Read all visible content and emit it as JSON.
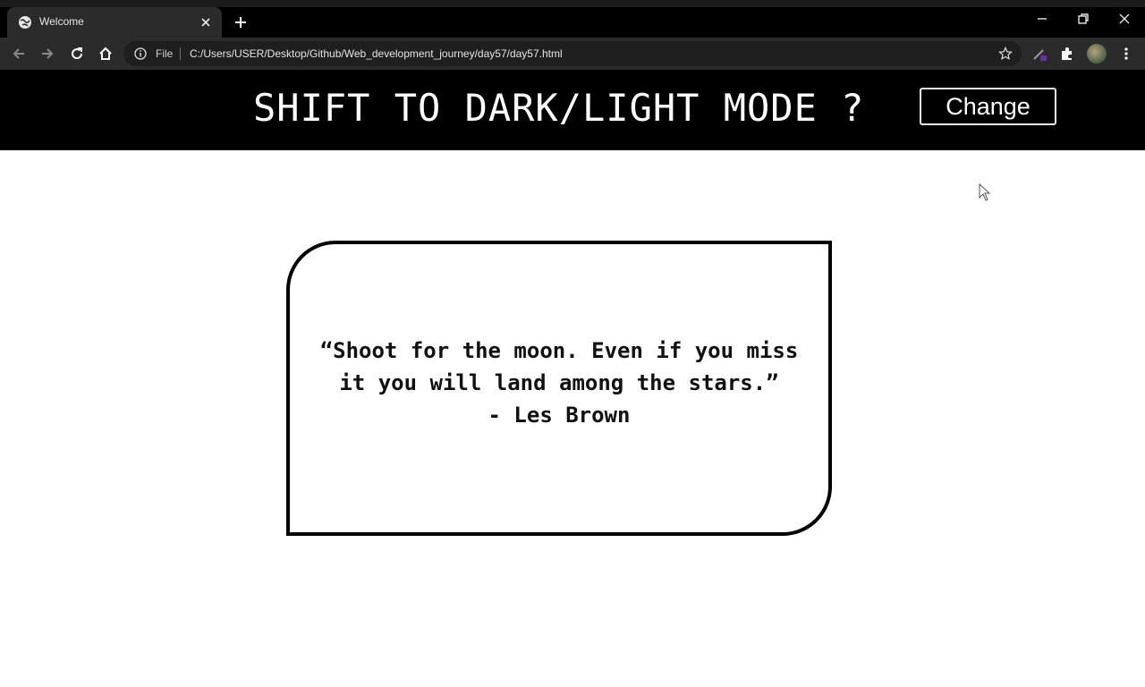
{
  "browser": {
    "tab_title": "Welcome",
    "scheme_label": "File",
    "url": "C:/Users/USER/Desktop/Github/Web_development_journey/day57/day57.html"
  },
  "page": {
    "heading": "SHIFT TO DARK/LIGHT MODE ?",
    "change_button": "Change",
    "quote": "“Shoot for the moon. Even if you miss it you will land among the stars.”",
    "author": "- Les Brown"
  },
  "colors": {
    "header_bg": "#000000",
    "page_bg": "#ffffff",
    "card_border": "#000000",
    "chrome_bg": "#2b2b2b"
  }
}
